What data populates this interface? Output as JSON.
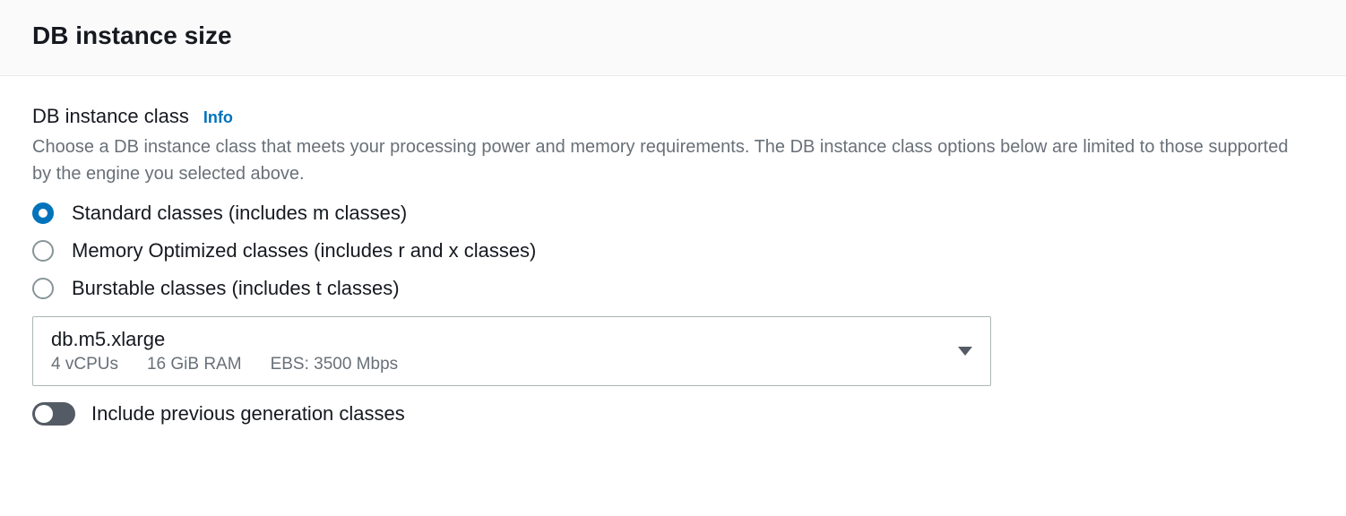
{
  "panel": {
    "title": "DB instance size"
  },
  "field": {
    "label": "DB instance class",
    "info": "Info",
    "description": "Choose a DB instance class that meets your processing power and memory requirements. The DB instance class options below are limited to those supported by the engine you selected above."
  },
  "radios": {
    "standard": "Standard classes (includes m classes)",
    "memory": "Memory Optimized classes (includes r and x classes)",
    "burstable": "Burstable classes (includes t classes)"
  },
  "select": {
    "main": "db.m5.xlarge",
    "vcpu": "4 vCPUs",
    "ram": "16 GiB RAM",
    "ebs": "EBS: 3500 Mbps"
  },
  "toggle": {
    "label": "Include previous generation classes"
  }
}
